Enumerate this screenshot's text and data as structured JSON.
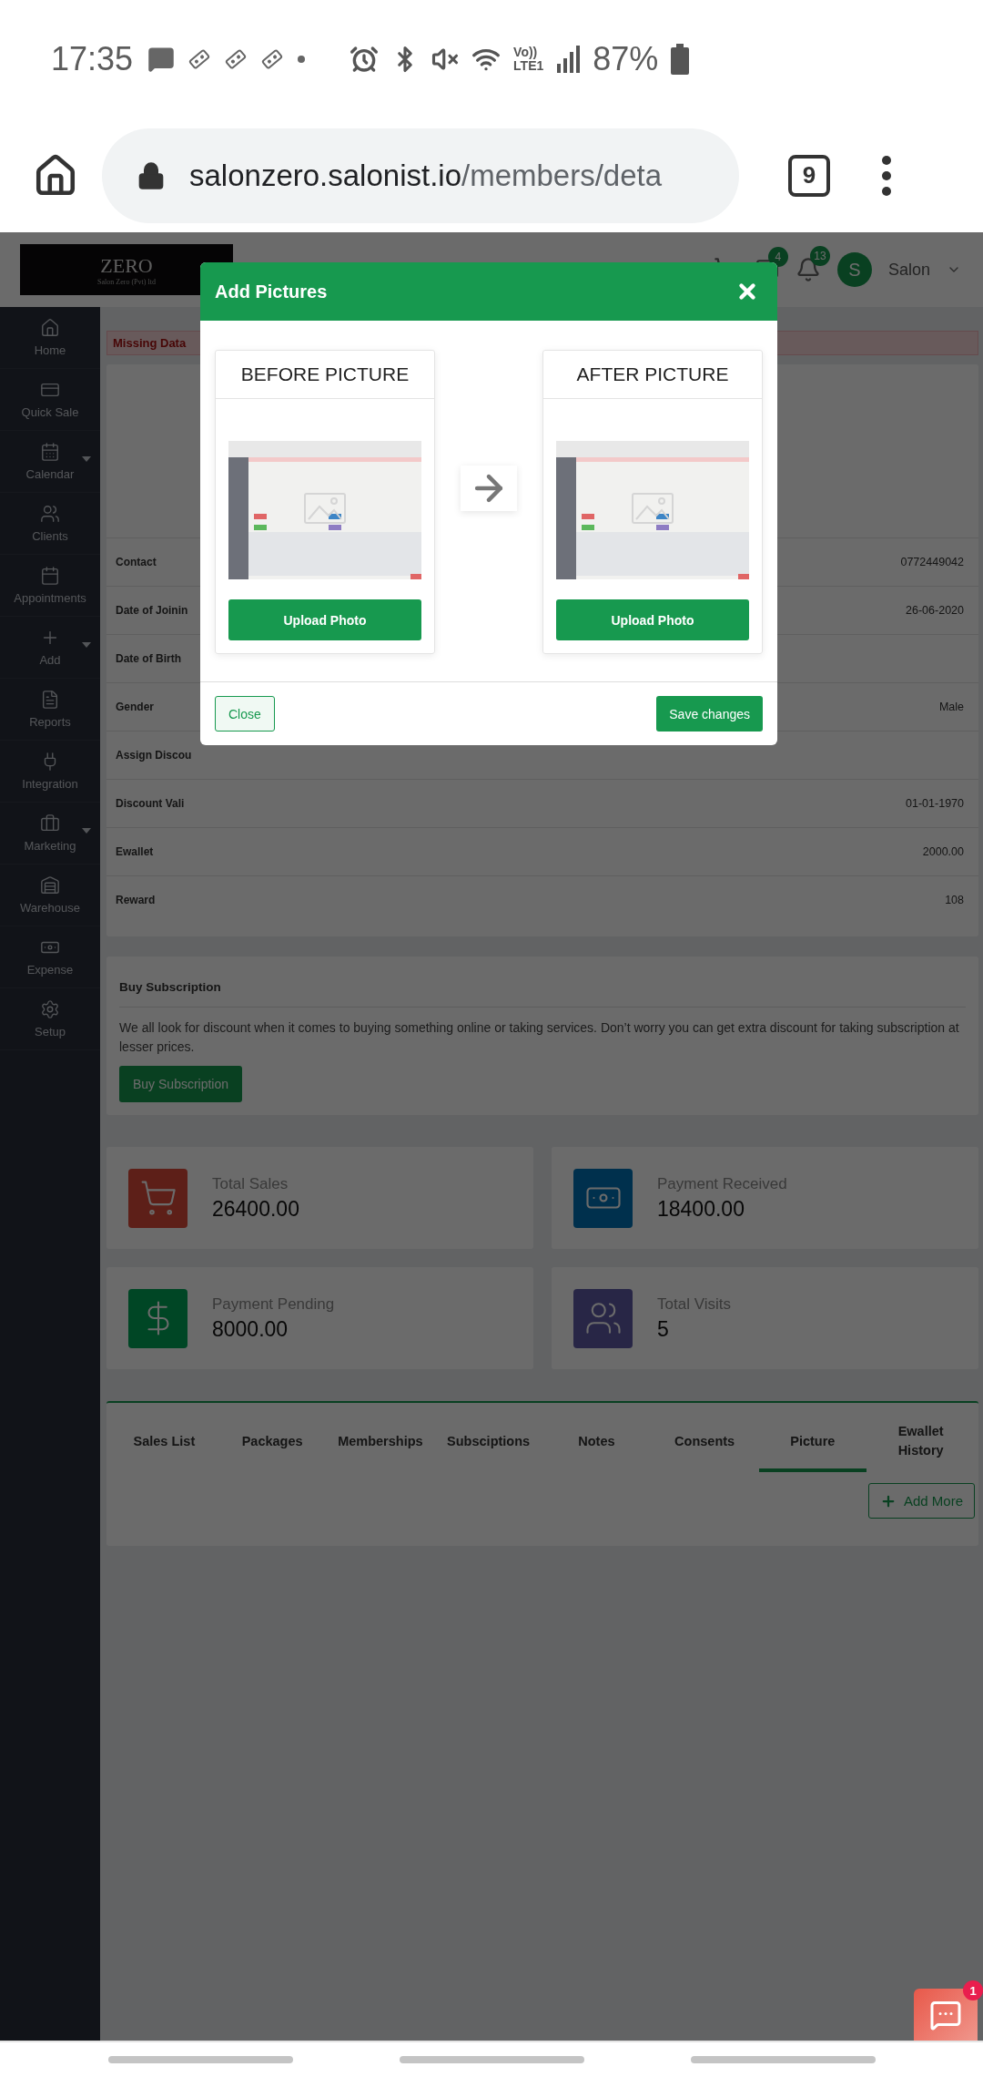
{
  "status_bar": {
    "time": "17:35",
    "network_top": "Vo))",
    "network_bottom": "LTE1",
    "battery": "87%"
  },
  "browser": {
    "url_host": "salonzero.salonist.io",
    "url_path": "/members/deta",
    "tab_count": "9"
  },
  "header": {
    "logo_title": "ZERO",
    "logo_subtitle": "Salon Zero (Pvt) ltd",
    "message_count": "4",
    "notification_count": "13",
    "avatar_initial": "S",
    "user_name": "Salon"
  },
  "sidebar": {
    "items": [
      {
        "label": "Home",
        "has_submenu": false
      },
      {
        "label": "Quick Sale",
        "has_submenu": false
      },
      {
        "label": "Calendar",
        "has_submenu": true
      },
      {
        "label": "Clients",
        "has_submenu": false
      },
      {
        "label": "Appointments",
        "has_submenu": false
      },
      {
        "label": "Add",
        "has_submenu": true
      },
      {
        "label": "Reports",
        "has_submenu": false
      },
      {
        "label": "Integration",
        "has_submenu": false
      },
      {
        "label": "Marketing",
        "has_submenu": true
      },
      {
        "label": "Warehouse",
        "has_submenu": false
      },
      {
        "label": "Expense",
        "has_submenu": false
      },
      {
        "label": "Setup",
        "has_submenu": false
      }
    ]
  },
  "alert": {
    "text": "Missing Data"
  },
  "profile": {
    "rows": [
      {
        "label": "Contact",
        "value": "0772449042"
      },
      {
        "label": "Date of Joinin",
        "value": "26-06-2020"
      },
      {
        "label": "Date of Birth"
      },
      {
        "label": "Gender",
        "value": "Male"
      },
      {
        "label": "Assign Discou"
      },
      {
        "label": "Discount Vali",
        "value": "01-01-1970"
      },
      {
        "label": "Ewallet",
        "value": "2000.00"
      },
      {
        "label": "Reward",
        "value": "108"
      }
    ]
  },
  "subscription": {
    "title": "Buy Subscription",
    "text": "We all look for discount when it comes to buying something online or taking services. Don’t worry you can get extra discount for taking subscription at lesser prices.",
    "button": "Buy Subscription"
  },
  "stats": [
    {
      "label": "Total Sales",
      "value": "26400.00"
    },
    {
      "label": "Payment Received",
      "value": "18400.00"
    },
    {
      "label": "Payment Pending",
      "value": "8000.00"
    },
    {
      "label": "Total Visits",
      "value": "5"
    }
  ],
  "tabs": [
    {
      "label": "Sales List",
      "selected": false
    },
    {
      "label": "Packages",
      "selected": false
    },
    {
      "label": "Memberships",
      "selected": false
    },
    {
      "label": "Subsciptions",
      "selected": false
    },
    {
      "label": "Notes",
      "selected": false
    },
    {
      "label": "Consents",
      "selected": false
    },
    {
      "label": "Picture",
      "selected": true
    },
    {
      "label": "Ewallet History",
      "selected": false
    }
  ],
  "add_more": "Add More",
  "modal": {
    "title": "Add Pictures",
    "panels": [
      {
        "title": "BEFORE PICTURE",
        "button": "Upload Photo"
      },
      {
        "title": "AFTER PICTURE",
        "button": "Upload Photo"
      }
    ],
    "close_button": "Close",
    "save_button": "Save changes"
  },
  "chat": {
    "badge": "1"
  }
}
